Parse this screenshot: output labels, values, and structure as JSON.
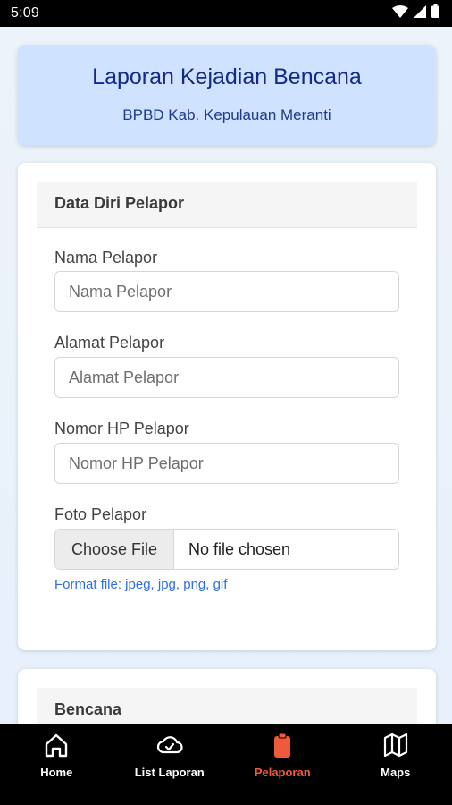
{
  "status_bar": {
    "time": "5:09",
    "icons": [
      "wifi-icon",
      "signal-icon",
      "battery-icon"
    ]
  },
  "header": {
    "title": "Laporan Kejadian Bencana",
    "subtitle": "BPBD Kab. Kepulauan Meranti"
  },
  "form": {
    "section_title": "Data Diri Pelapor",
    "fields": [
      {
        "label": "Nama Pelapor",
        "placeholder": "Nama Pelapor",
        "value": ""
      },
      {
        "label": "Alamat Pelapor",
        "placeholder": "Alamat Pelapor",
        "value": ""
      },
      {
        "label": "Nomor HP Pelapor",
        "placeholder": "Nomor HP Pelapor",
        "value": ""
      }
    ],
    "photo": {
      "label": "Foto Pelapor",
      "button_label": "Choose File",
      "status": "No file chosen",
      "hint": "Format file: jpeg, jpg, png, gif"
    }
  },
  "section2": {
    "title": "Bencana"
  },
  "nav": {
    "items": [
      {
        "label": "Home",
        "icon": "home-icon"
      },
      {
        "label": "List Laporan",
        "icon": "cloud-check-icon"
      },
      {
        "label": "Pelaporan",
        "icon": "clipboard-icon",
        "active": true
      },
      {
        "label": "Maps",
        "icon": "map-icon"
      }
    ]
  },
  "colors": {
    "accent": "#f05a3c",
    "header_bg": "#cfe2ff",
    "title": "#142a8a",
    "hint": "#2e6ee6"
  }
}
